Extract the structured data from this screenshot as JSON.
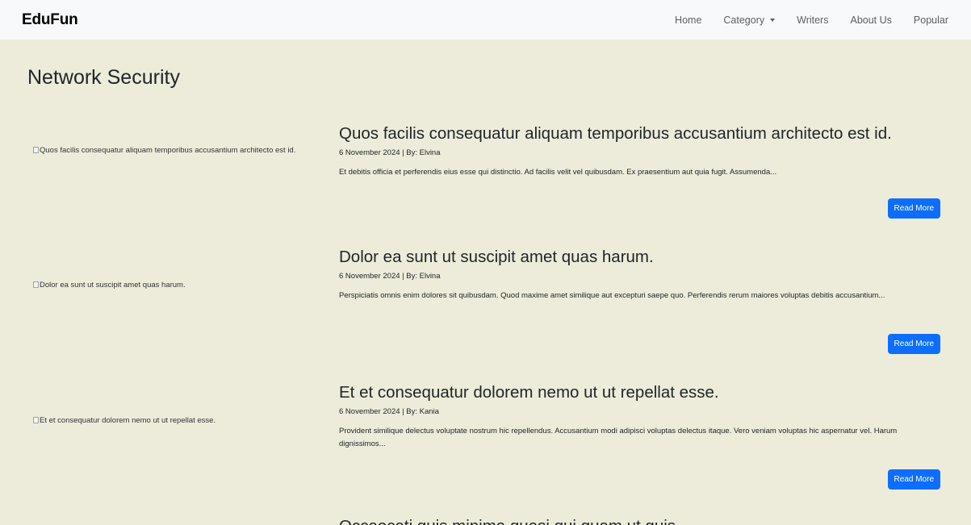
{
  "navbar": {
    "brand": "EduFun",
    "links": [
      {
        "label": "Home"
      },
      {
        "label": "Category"
      },
      {
        "label": "Writers"
      },
      {
        "label": "About Us"
      },
      {
        "label": "Popular"
      }
    ]
  },
  "page": {
    "title": "Network Security"
  },
  "articles": [
    {
      "image_alt": "Quos facilis consequatur aliquam temporibus accusantium architecto est id.",
      "title": "Quos facilis consequatur aliquam temporibus accusantium architecto est id.",
      "meta": "6 November 2024 | By: Elvina",
      "excerpt": "Et debitis officia et perferendis eius esse qui distinctio. Ad facilis velit vel quibusdam. Ex praesentium aut quia fugit. Assumenda...",
      "button": "Read More"
    },
    {
      "image_alt": "Dolor ea sunt ut suscipit amet quas harum.",
      "title": "Dolor ea sunt ut suscipit amet quas harum.",
      "meta": "6 November 2024 | By: Elvina",
      "excerpt": "Perspiciatis omnis enim dolores sit quibusdam. Quod maxime amet similique aut excepturi saepe quo. Perferendis rerum maiores voluptas debitis accusantium...",
      "button": "Read More"
    },
    {
      "image_alt": "Et et consequatur dolorem nemo ut ut repellat esse.",
      "title": "Et et consequatur dolorem nemo ut ut repellat esse.",
      "meta": "6 November 2024 | By: Kania",
      "excerpt": "Provident similique delectus voluptate nostrum hic repellendus. Accusantium modi adipisci voluptas delectus itaque. Vero veniam voluptas hic aspernatur vel. Harum dignissimos...",
      "button": "Read More"
    },
    {
      "title": "Occaecati quis minima quasi qui quam ut quis."
    }
  ]
}
